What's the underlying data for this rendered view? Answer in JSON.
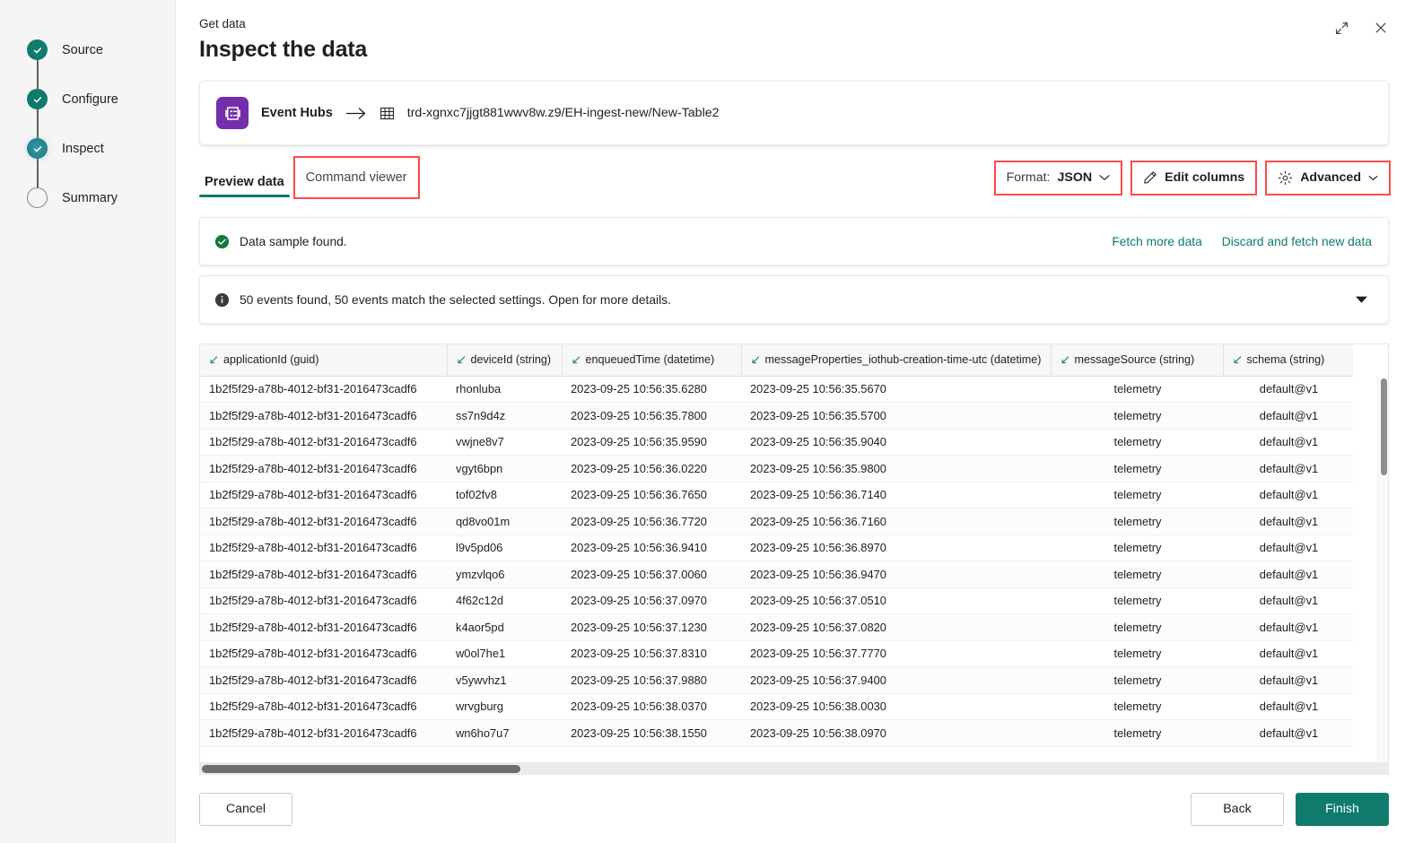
{
  "sidebar": {
    "steps": [
      {
        "label": "Source",
        "state": "done"
      },
      {
        "label": "Configure",
        "state": "done"
      },
      {
        "label": "Inspect",
        "state": "current"
      },
      {
        "label": "Summary",
        "state": "pending"
      }
    ]
  },
  "header": {
    "eyebrow": "Get data",
    "title": "Inspect the data",
    "expand_icon": "expand-icon",
    "close_icon": "close-icon"
  },
  "source_card": {
    "icon": "event-hubs-icon",
    "source_name": "Event Hubs",
    "arrow_icon": "arrow-right-icon",
    "destination_icon": "table-icon",
    "destination_path": "trd-xgnxc7jjgt881wwv8w.z9/EH-ingest-new/New-Table2"
  },
  "tabs": [
    {
      "label": "Preview data",
      "active": true,
      "highlighted": false
    },
    {
      "label": "Command viewer",
      "active": false,
      "highlighted": true
    }
  ],
  "toolbar": {
    "format_label": "Format:",
    "format_value": "JSON",
    "format_chevron_icon": "chevron-down-icon",
    "edit_columns_label": "Edit columns",
    "edit_columns_icon": "pencil-icon",
    "advanced_label": "Advanced",
    "advanced_icon": "gear-icon",
    "advanced_chevron_icon": "chevron-down-icon"
  },
  "banners": {
    "success": {
      "icon": "success-check-icon",
      "text": "Data sample found.",
      "links": [
        "Fetch more data",
        "Discard and fetch new data"
      ]
    },
    "info": {
      "icon": "info-icon",
      "text": "50 events found, 50 events match the selected settings. Open for more details.",
      "caret_icon": "caret-down-icon"
    }
  },
  "grid": {
    "sort_icon": "sort-arrow-icon",
    "columns": [
      "applicationId (guid)",
      "deviceId (string)",
      "enqueuedTime (datetime)",
      "messageProperties_iothub-creation-time-utc (datetime)",
      "messageSource (string)",
      "schema (string)"
    ],
    "rows": [
      [
        "1b2f5f29-a78b-4012-bf31-2016473cadf6",
        "rhonluba",
        "2023-09-25 10:56:35.6280",
        "2023-09-25 10:56:35.5670",
        "telemetry",
        "default@v1"
      ],
      [
        "1b2f5f29-a78b-4012-bf31-2016473cadf6",
        "ss7n9d4z",
        "2023-09-25 10:56:35.7800",
        "2023-09-25 10:56:35.5700",
        "telemetry",
        "default@v1"
      ],
      [
        "1b2f5f29-a78b-4012-bf31-2016473cadf6",
        "vwjne8v7",
        "2023-09-25 10:56:35.9590",
        "2023-09-25 10:56:35.9040",
        "telemetry",
        "default@v1"
      ],
      [
        "1b2f5f29-a78b-4012-bf31-2016473cadf6",
        "vgyt6bpn",
        "2023-09-25 10:56:36.0220",
        "2023-09-25 10:56:35.9800",
        "telemetry",
        "default@v1"
      ],
      [
        "1b2f5f29-a78b-4012-bf31-2016473cadf6",
        "tof02fv8",
        "2023-09-25 10:56:36.7650",
        "2023-09-25 10:56:36.7140",
        "telemetry",
        "default@v1"
      ],
      [
        "1b2f5f29-a78b-4012-bf31-2016473cadf6",
        "qd8vo01m",
        "2023-09-25 10:56:36.7720",
        "2023-09-25 10:56:36.7160",
        "telemetry",
        "default@v1"
      ],
      [
        "1b2f5f29-a78b-4012-bf31-2016473cadf6",
        "l9v5pd06",
        "2023-09-25 10:56:36.9410",
        "2023-09-25 10:56:36.8970",
        "telemetry",
        "default@v1"
      ],
      [
        "1b2f5f29-a78b-4012-bf31-2016473cadf6",
        "ymzvlqo6",
        "2023-09-25 10:56:37.0060",
        "2023-09-25 10:56:36.9470",
        "telemetry",
        "default@v1"
      ],
      [
        "1b2f5f29-a78b-4012-bf31-2016473cadf6",
        "4f62c12d",
        "2023-09-25 10:56:37.0970",
        "2023-09-25 10:56:37.0510",
        "telemetry",
        "default@v1"
      ],
      [
        "1b2f5f29-a78b-4012-bf31-2016473cadf6",
        "k4aor5pd",
        "2023-09-25 10:56:37.1230",
        "2023-09-25 10:56:37.0820",
        "telemetry",
        "default@v1"
      ],
      [
        "1b2f5f29-a78b-4012-bf31-2016473cadf6",
        "w0ol7he1",
        "2023-09-25 10:56:37.8310",
        "2023-09-25 10:56:37.7770",
        "telemetry",
        "default@v1"
      ],
      [
        "1b2f5f29-a78b-4012-bf31-2016473cadf6",
        "v5ywvhz1",
        "2023-09-25 10:56:37.9880",
        "2023-09-25 10:56:37.9400",
        "telemetry",
        "default@v1"
      ],
      [
        "1b2f5f29-a78b-4012-bf31-2016473cadf6",
        "wrvgburg",
        "2023-09-25 10:56:38.0370",
        "2023-09-25 10:56:38.0030",
        "telemetry",
        "default@v1"
      ],
      [
        "1b2f5f29-a78b-4012-bf31-2016473cadf6",
        "wn6ho7u7",
        "2023-09-25 10:56:38.1550",
        "2023-09-25 10:56:38.0970",
        "telemetry",
        "default@v1"
      ]
    ]
  },
  "footer": {
    "cancel_label": "Cancel",
    "back_label": "Back",
    "finish_label": "Finish"
  },
  "colors": {
    "accent_teal": "#0f7b6c",
    "event_hubs_purple": "#742dab",
    "highlight_red": "#fc4a4a"
  }
}
